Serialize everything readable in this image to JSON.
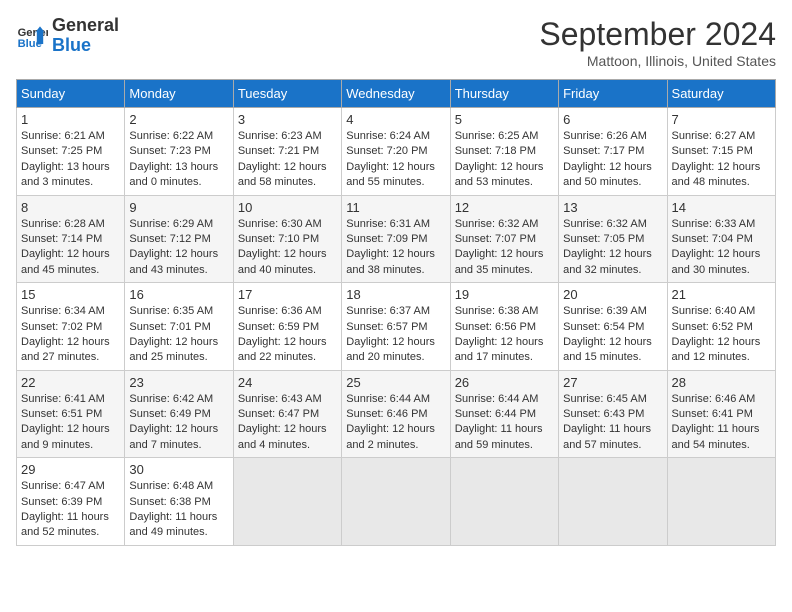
{
  "header": {
    "logo_line1": "General",
    "logo_line2": "Blue",
    "month": "September 2024",
    "location": "Mattoon, Illinois, United States"
  },
  "weekdays": [
    "Sunday",
    "Monday",
    "Tuesday",
    "Wednesday",
    "Thursday",
    "Friday",
    "Saturday"
  ],
  "weeks": [
    [
      {
        "day": "1",
        "sunrise": "6:21 AM",
        "sunset": "7:25 PM",
        "daylight": "13 hours and 3 minutes."
      },
      {
        "day": "2",
        "sunrise": "6:22 AM",
        "sunset": "7:23 PM",
        "daylight": "13 hours and 0 minutes."
      },
      {
        "day": "3",
        "sunrise": "6:23 AM",
        "sunset": "7:21 PM",
        "daylight": "12 hours and 58 minutes."
      },
      {
        "day": "4",
        "sunrise": "6:24 AM",
        "sunset": "7:20 PM",
        "daylight": "12 hours and 55 minutes."
      },
      {
        "day": "5",
        "sunrise": "6:25 AM",
        "sunset": "7:18 PM",
        "daylight": "12 hours and 53 minutes."
      },
      {
        "day": "6",
        "sunrise": "6:26 AM",
        "sunset": "7:17 PM",
        "daylight": "12 hours and 50 minutes."
      },
      {
        "day": "7",
        "sunrise": "6:27 AM",
        "sunset": "7:15 PM",
        "daylight": "12 hours and 48 minutes."
      }
    ],
    [
      {
        "day": "8",
        "sunrise": "6:28 AM",
        "sunset": "7:14 PM",
        "daylight": "12 hours and 45 minutes."
      },
      {
        "day": "9",
        "sunrise": "6:29 AM",
        "sunset": "7:12 PM",
        "daylight": "12 hours and 43 minutes."
      },
      {
        "day": "10",
        "sunrise": "6:30 AM",
        "sunset": "7:10 PM",
        "daylight": "12 hours and 40 minutes."
      },
      {
        "day": "11",
        "sunrise": "6:31 AM",
        "sunset": "7:09 PM",
        "daylight": "12 hours and 38 minutes."
      },
      {
        "day": "12",
        "sunrise": "6:32 AM",
        "sunset": "7:07 PM",
        "daylight": "12 hours and 35 minutes."
      },
      {
        "day": "13",
        "sunrise": "6:32 AM",
        "sunset": "7:05 PM",
        "daylight": "12 hours and 32 minutes."
      },
      {
        "day": "14",
        "sunrise": "6:33 AM",
        "sunset": "7:04 PM",
        "daylight": "12 hours and 30 minutes."
      }
    ],
    [
      {
        "day": "15",
        "sunrise": "6:34 AM",
        "sunset": "7:02 PM",
        "daylight": "12 hours and 27 minutes."
      },
      {
        "day": "16",
        "sunrise": "6:35 AM",
        "sunset": "7:01 PM",
        "daylight": "12 hours and 25 minutes."
      },
      {
        "day": "17",
        "sunrise": "6:36 AM",
        "sunset": "6:59 PM",
        "daylight": "12 hours and 22 minutes."
      },
      {
        "day": "18",
        "sunrise": "6:37 AM",
        "sunset": "6:57 PM",
        "daylight": "12 hours and 20 minutes."
      },
      {
        "day": "19",
        "sunrise": "6:38 AM",
        "sunset": "6:56 PM",
        "daylight": "12 hours and 17 minutes."
      },
      {
        "day": "20",
        "sunrise": "6:39 AM",
        "sunset": "6:54 PM",
        "daylight": "12 hours and 15 minutes."
      },
      {
        "day": "21",
        "sunrise": "6:40 AM",
        "sunset": "6:52 PM",
        "daylight": "12 hours and 12 minutes."
      }
    ],
    [
      {
        "day": "22",
        "sunrise": "6:41 AM",
        "sunset": "6:51 PM",
        "daylight": "12 hours and 9 minutes."
      },
      {
        "day": "23",
        "sunrise": "6:42 AM",
        "sunset": "6:49 PM",
        "daylight": "12 hours and 7 minutes."
      },
      {
        "day": "24",
        "sunrise": "6:43 AM",
        "sunset": "6:47 PM",
        "daylight": "12 hours and 4 minutes."
      },
      {
        "day": "25",
        "sunrise": "6:44 AM",
        "sunset": "6:46 PM",
        "daylight": "12 hours and 2 minutes."
      },
      {
        "day": "26",
        "sunrise": "6:44 AM",
        "sunset": "6:44 PM",
        "daylight": "11 hours and 59 minutes."
      },
      {
        "day": "27",
        "sunrise": "6:45 AM",
        "sunset": "6:43 PM",
        "daylight": "11 hours and 57 minutes."
      },
      {
        "day": "28",
        "sunrise": "6:46 AM",
        "sunset": "6:41 PM",
        "daylight": "11 hours and 54 minutes."
      }
    ],
    [
      {
        "day": "29",
        "sunrise": "6:47 AM",
        "sunset": "6:39 PM",
        "daylight": "11 hours and 52 minutes."
      },
      {
        "day": "30",
        "sunrise": "6:48 AM",
        "sunset": "6:38 PM",
        "daylight": "11 hours and 49 minutes."
      },
      null,
      null,
      null,
      null,
      null
    ]
  ]
}
